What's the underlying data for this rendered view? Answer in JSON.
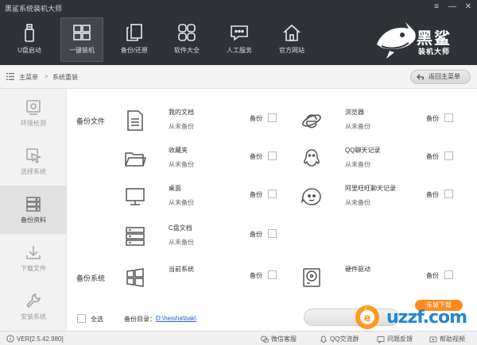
{
  "window": {
    "title": "黑鲨系统装机大师",
    "controls": [
      "≡",
      "—",
      "✕"
    ]
  },
  "nav": {
    "items": [
      {
        "label": "U盘启动",
        "icon": "usb-drive-icon"
      },
      {
        "label": "一键装机",
        "icon": "windows-grid-icon",
        "active": true
      },
      {
        "label": "备份/还原",
        "icon": "copy-icon"
      },
      {
        "label": "软件大全",
        "icon": "apps-grid-icon"
      },
      {
        "label": "人工服务",
        "icon": "chat-bubble-icon"
      },
      {
        "label": "官方网站",
        "icon": "home-icon"
      }
    ],
    "brand": "黑鲨",
    "brand_sub": "装机大师"
  },
  "breadcrumb": {
    "root": "主菜单",
    "separator": ">",
    "current": "系统重装",
    "back_label": "返回主菜单"
  },
  "sidebar": {
    "items": [
      {
        "label": "环境检测",
        "icon": "environment-check-icon"
      },
      {
        "label": "选择系统",
        "icon": "cursor-select-icon"
      },
      {
        "label": "备份资料",
        "icon": "database-icon",
        "active": true
      },
      {
        "label": "下载文件",
        "icon": "download-icon"
      },
      {
        "label": "安装系统",
        "icon": "wrench-icon"
      }
    ]
  },
  "content": {
    "section_files": "备份文件",
    "section_system": "备份系统",
    "files": [
      {
        "name": "我的文档",
        "status": "从未备份",
        "check_label": "备份",
        "icon": "document-icon"
      },
      {
        "name": "浏览器",
        "status": "从未备份",
        "check_label": "备份",
        "icon": "ie-browser-icon"
      },
      {
        "name": "收藏夹",
        "status": "从未备份",
        "check_label": "备份",
        "icon": "folder-icon"
      },
      {
        "name": "QQ聊天记录",
        "status": "从未备份",
        "check_label": "备份",
        "icon": "qq-penguin-icon"
      },
      {
        "name": "桌面",
        "status": "从未备份",
        "check_label": "备份",
        "icon": "monitor-icon"
      },
      {
        "name": "阿里旺旺聊天记录",
        "status": "从未备份",
        "check_label": "备份",
        "icon": "aliwangwang-icon"
      },
      {
        "name": "C盘文档",
        "status": "从未备份",
        "check_label": "备份",
        "icon": "server-stack-icon"
      }
    ],
    "system": [
      {
        "name": "当前系统",
        "check_label": "备份",
        "icon": "windows-logo-icon"
      },
      {
        "name": "硬件驱动",
        "check_label": "备份",
        "icon": "hard-drive-icon"
      }
    ],
    "select_all": "全选",
    "dir_label": "备份目录：",
    "dir_value": "D:\\heisha\\bak\\"
  },
  "watermark": {
    "pill": "东坡下载",
    "text": "uzzf.com"
  },
  "statusbar": {
    "version": "VER[2.5.42.980]",
    "links": [
      {
        "label": "微信客服",
        "icon": "wechat-icon"
      },
      {
        "label": "QQ交流群",
        "icon": "qq-icon"
      },
      {
        "label": "问题反馈",
        "icon": "feedback-icon"
      },
      {
        "label": "帮助视频",
        "icon": "help-video-icon"
      }
    ]
  }
}
